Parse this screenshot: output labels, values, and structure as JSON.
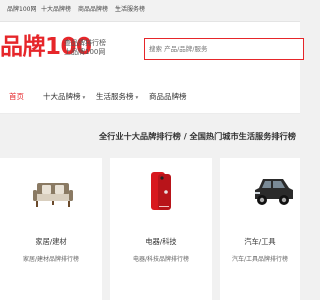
{
  "topbar": {
    "links": [
      "品牌100网",
      "十大品牌榜",
      "商品品牌榜",
      "生活服务榜"
    ]
  },
  "header": {
    "logo_text": "品牌100",
    "slogan_line1": "查品牌排行榜",
    "slogan_line2": "上品牌100网",
    "search_placeholder": "搜索 产品/品牌/服务"
  },
  "nav": {
    "items": [
      {
        "label": "首页",
        "active": true,
        "dropdown": false
      },
      {
        "label": "十大品牌榜",
        "active": false,
        "dropdown": true
      },
      {
        "label": "生活服务榜",
        "active": false,
        "dropdown": true
      },
      {
        "label": "商品品牌榜",
        "active": false,
        "dropdown": false
      }
    ]
  },
  "section": {
    "heading": "全行业十大品牌排行榜 / 全国热门城市生活服务排行榜"
  },
  "categories": [
    {
      "title": "家居/建材",
      "subtitle": "家居/建材品牌排行榜",
      "icon": "sofa-icon"
    },
    {
      "title": "电器/科技",
      "subtitle": "电器/科技品牌排行榜",
      "icon": "smartphone-icon"
    },
    {
      "title": "汽车/工具",
      "subtitle": "汽车/工具品牌排行榜",
      "icon": "suv-car-icon"
    }
  ],
  "colors": {
    "accent": "#e6262a",
    "background": "#f1f1f1",
    "card": "#ffffff"
  }
}
